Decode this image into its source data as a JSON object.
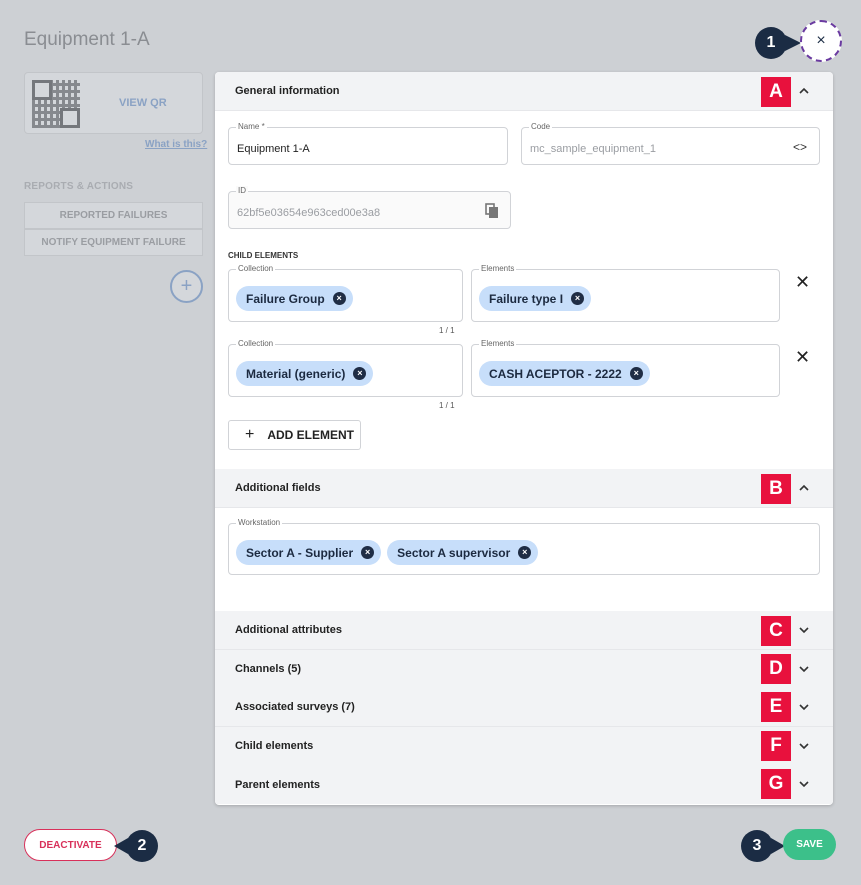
{
  "page": {
    "title": "Equipment 1-A",
    "view_qr": "VIEW QR",
    "what_is_this": "What is this?",
    "reports_title": "REPORTS & ACTIONS",
    "reported_failures": "REPORTED FAILURES",
    "notify_failure": "NOTIFY EQUIPMENT FAILURE",
    "plus": "+"
  },
  "general": {
    "header": "General information",
    "badge": "A",
    "name_label": "Name *",
    "name_value": "Equipment 1-A",
    "code_label": "Code",
    "code_value": "mc_sample_equipment_1",
    "code_icon": "<>",
    "id_label": "ID",
    "id_value": "62bf5e03654e963ced00e3a8",
    "child_title": "CHILD ELEMENTS",
    "rows": [
      {
        "collection_label": "Collection",
        "collection_chip": "Failure Group",
        "counter": "1 / 1",
        "elements_label": "Elements",
        "elements_chip": "Failure type I"
      },
      {
        "collection_label": "Collection",
        "collection_chip": "Material (generic)",
        "counter": "1 / 1",
        "elements_label": "Elements",
        "elements_chip": "CASH ACEPTOR - 2222"
      }
    ],
    "add_element": "ADD ELEMENT"
  },
  "additional_fields": {
    "header": "Additional fields",
    "badge": "B",
    "workstation_label": "Workstation",
    "chips": [
      "Sector A - Supplier",
      "Sector A supervisor"
    ]
  },
  "collapsed_sections": [
    {
      "label": "Additional attributes",
      "badge": "C"
    },
    {
      "label": "Channels (5)",
      "badge": "D"
    },
    {
      "label": "Associated surveys (7)",
      "badge": "E"
    },
    {
      "label": "Child elements",
      "badge": "F"
    },
    {
      "label": "Parent elements",
      "badge": "G"
    }
  ],
  "footer": {
    "deactivate": "DEACTIVATE",
    "save": "SAVE"
  },
  "callouts": {
    "close": "1",
    "deactivate": "2",
    "save": "3",
    "close_symbol": "×",
    "chip_x": "×",
    "row_x": "✕"
  }
}
